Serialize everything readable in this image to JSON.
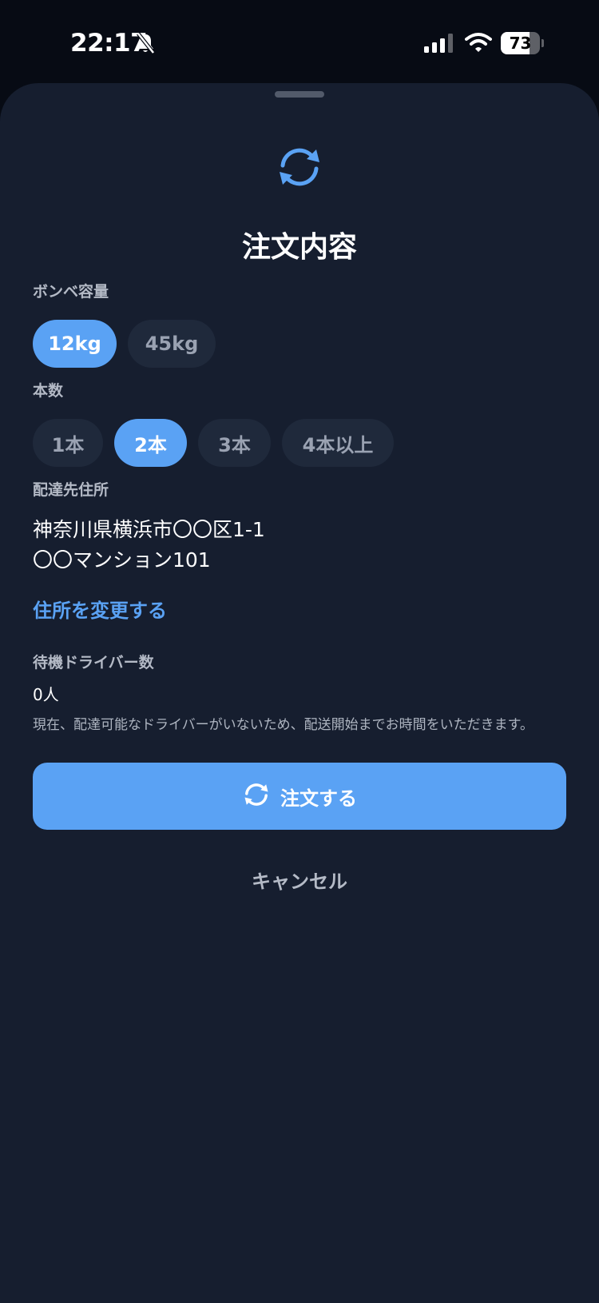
{
  "status_bar": {
    "time": "22:17",
    "battery_level": "73",
    "battery_fraction": 0.73
  },
  "colors": {
    "accent": "#5aa2f4",
    "sheet_background": "#161e2f",
    "chip_background": "#1f293b"
  },
  "sheet": {
    "top_icon": "refresh-icon",
    "title": "注文内容",
    "capacity": {
      "label": "ボンベ容量",
      "options": [
        "12kg",
        "45kg"
      ],
      "selected": "12kg"
    },
    "quantity": {
      "label": "本数",
      "options": [
        "1本",
        "2本",
        "3本",
        "4本以上"
      ],
      "selected": "2本"
    },
    "address": {
      "label": "配達先住所",
      "line1": "神奈川県横浜市〇〇区1-1",
      "line2": "〇〇マンション101",
      "change_link": "住所を変更する"
    },
    "drivers": {
      "label": "待機ドライバー数",
      "count": "0人",
      "note": "現在、配達可能なドライバーがいないため、配送開始までお時間をいただきます。"
    },
    "order_button": {
      "label": "注文する",
      "icon": "refresh-icon"
    },
    "cancel_button": "キャンセル"
  }
}
